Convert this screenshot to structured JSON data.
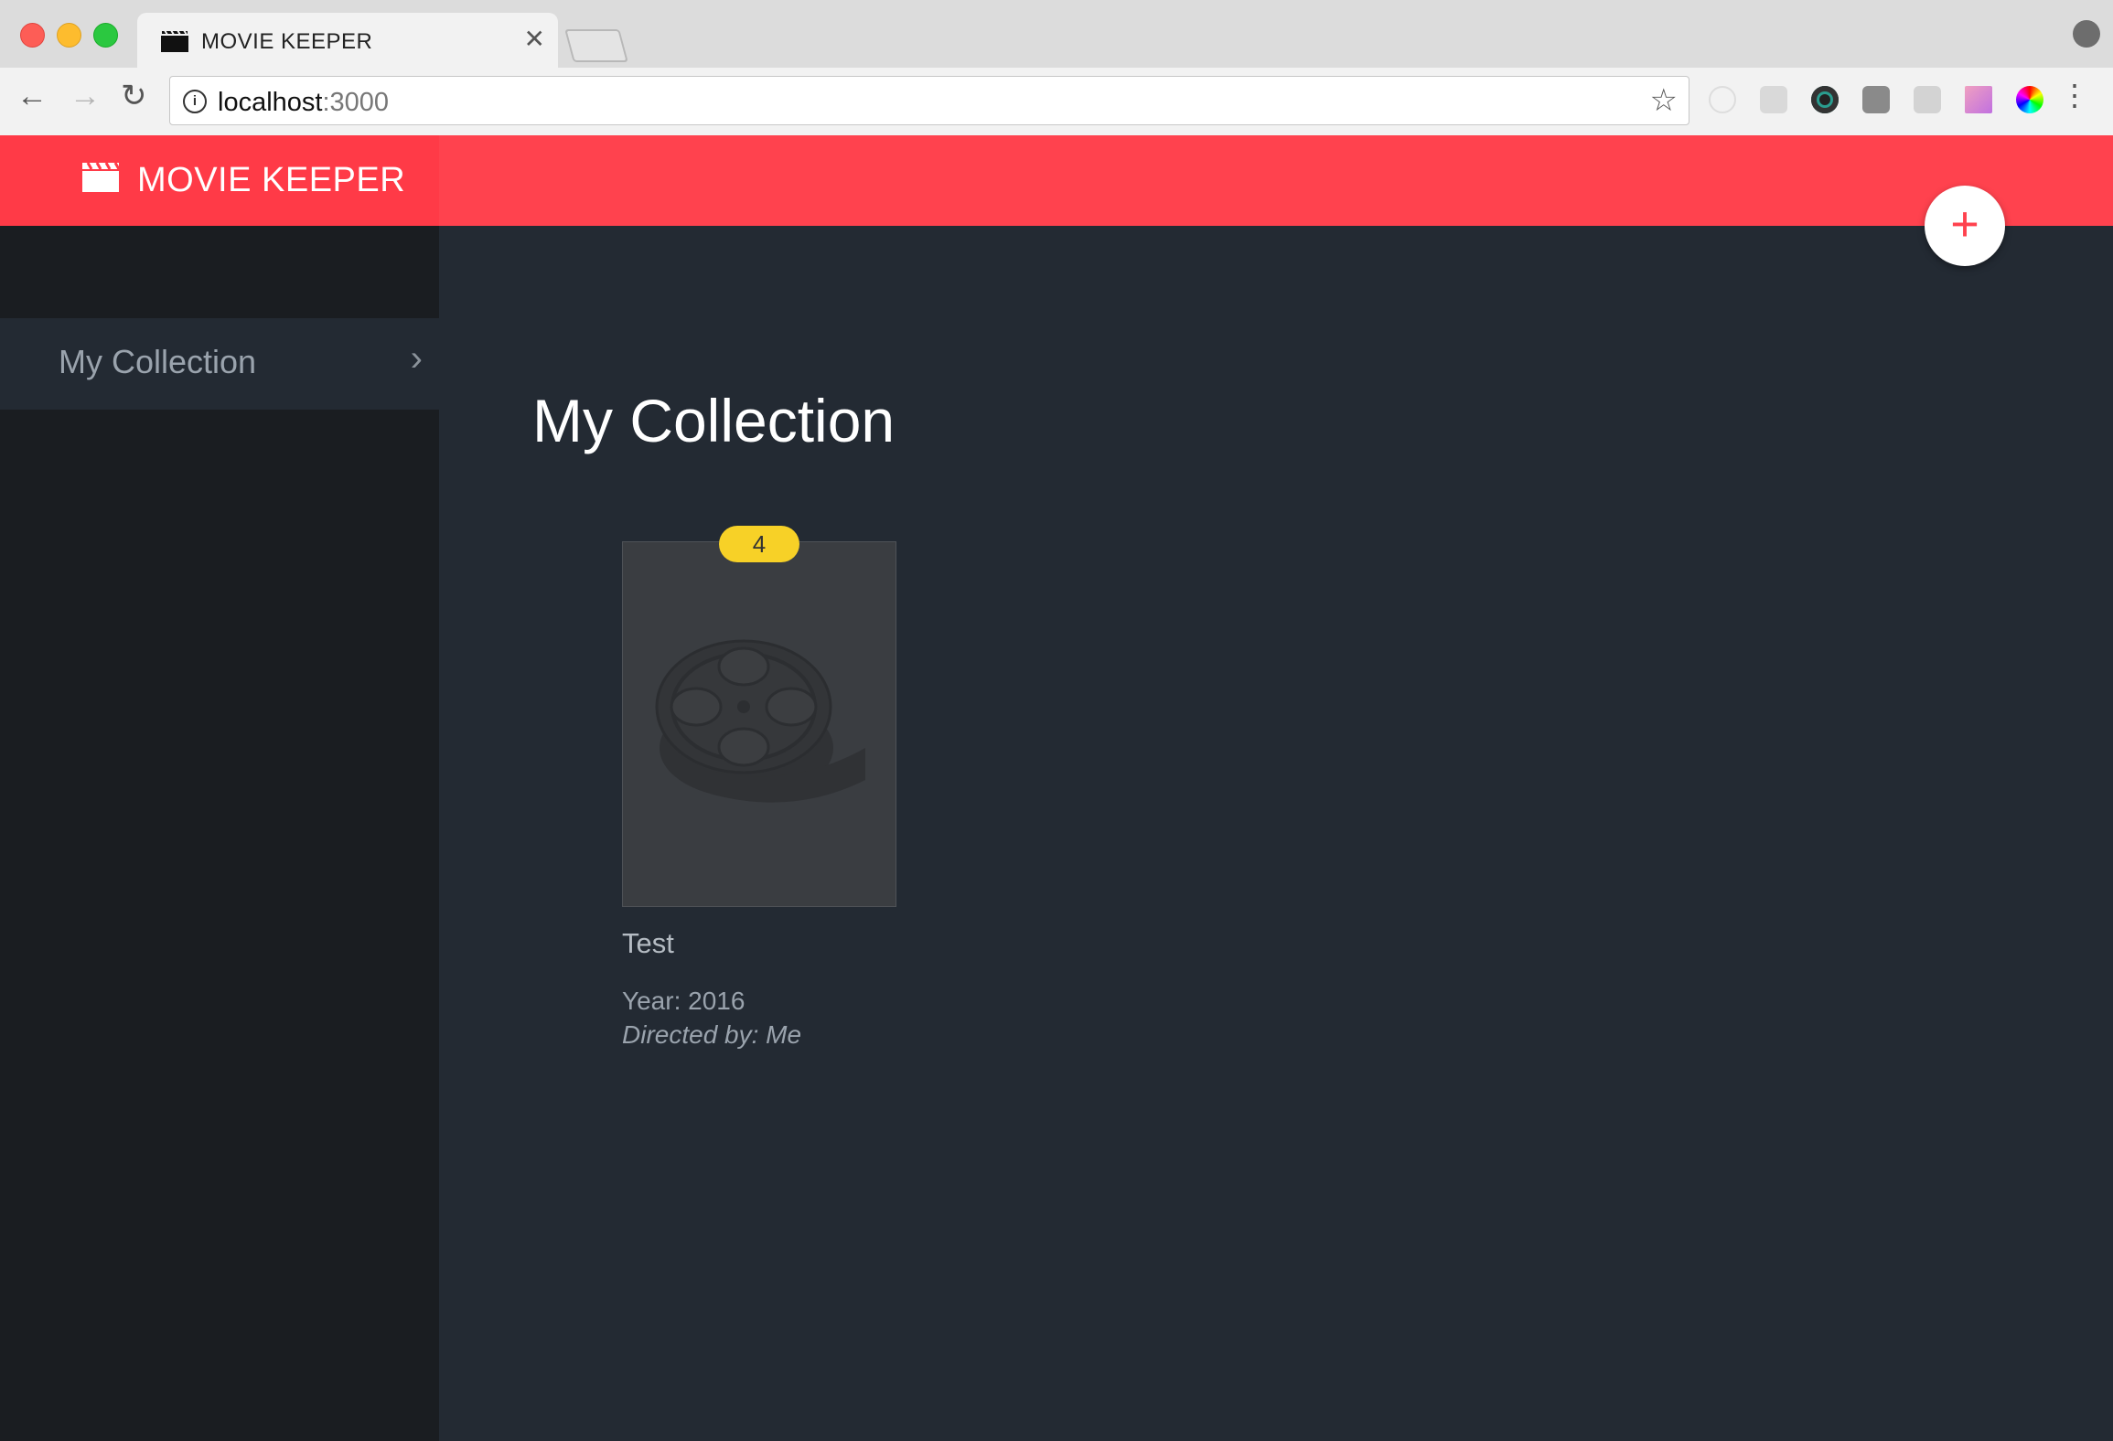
{
  "browser": {
    "tab": {
      "title": "MOVIE KEEPER",
      "close_symbol": "✕"
    },
    "url": {
      "host": "localhost",
      "port": ":3000"
    },
    "extensions": [
      "ghost-extension-icon",
      "react-devtools-icon",
      "camera-extension-icon",
      "shield-extension-icon",
      "play-extension-icon",
      "gradient-extension-icon",
      "color-wheel-extension-icon"
    ]
  },
  "app": {
    "brand": "MOVIE KEEPER",
    "accent_color": "#ff424e",
    "add_symbol": "+"
  },
  "sidebar": {
    "items": [
      {
        "label": "My Collection",
        "chevron": "›"
      }
    ]
  },
  "main": {
    "title": "My Collection",
    "movies": [
      {
        "title": "Test",
        "rating": "4",
        "year_text": "Year: 2016",
        "director_text": "Directed by: Me",
        "rating_color": "#f7d127"
      }
    ]
  }
}
